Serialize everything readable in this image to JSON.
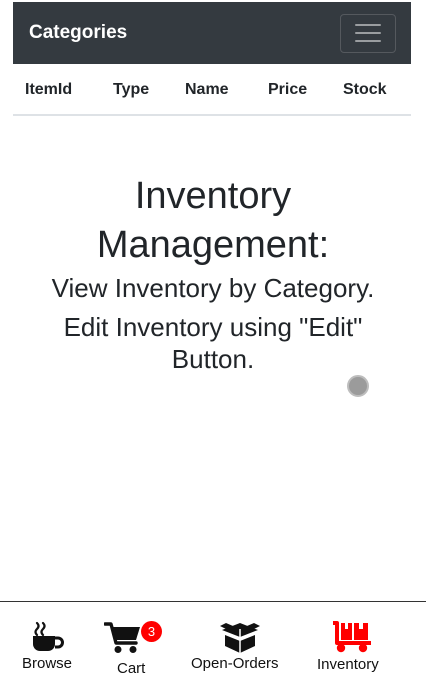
{
  "navbar": {
    "brand": "Categories"
  },
  "table": {
    "headers": [
      "ItemId",
      "Type",
      "Name",
      "Price",
      "Stock"
    ]
  },
  "hero": {
    "title_line1": "Inventory",
    "title_line2": "Management:",
    "subtitle": "View Inventory by Category.",
    "instruction_line1": "Edit Inventory using \"Edit\"",
    "instruction_line2": "Button."
  },
  "bottom_nav": {
    "items": [
      {
        "label": "Browse",
        "icon": "coffee-icon"
      },
      {
        "label": "Cart",
        "icon": "cart-icon",
        "badge": "3"
      },
      {
        "label": "Open-Orders",
        "icon": "box-open-icon"
      },
      {
        "label": "Inventory",
        "icon": "dolly-icon"
      }
    ]
  },
  "colors": {
    "navbar_bg": "#343a40",
    "active": "#ff0000",
    "badge": "#ff0000"
  }
}
